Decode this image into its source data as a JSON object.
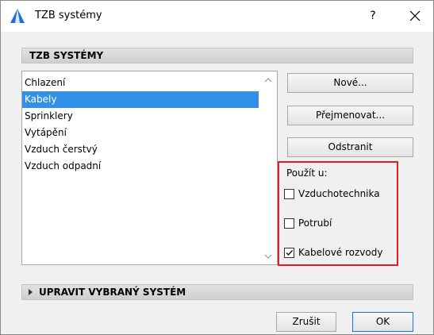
{
  "window": {
    "title": "TZB systémy",
    "help_label": "?",
    "accent_color": "#3390e8"
  },
  "systems_section": {
    "header": "TZB SYSTÉMY",
    "items": [
      {
        "label": "Chlazení",
        "selected": false
      },
      {
        "label": "Kabely",
        "selected": true
      },
      {
        "label": "Sprinklery",
        "selected": false
      },
      {
        "label": "Vytápění",
        "selected": false
      },
      {
        "label": "Vzduch čerstvý",
        "selected": false
      },
      {
        "label": "Vzduch odpadní",
        "selected": false
      }
    ]
  },
  "actions": {
    "new_label": "Nové...",
    "rename_label": "Přejmenovat...",
    "remove_label": "Odstranit"
  },
  "usage": {
    "label": "Použít u:",
    "options": [
      {
        "label": "Vzduchotechnika",
        "checked": false
      },
      {
        "label": "Potrubí",
        "checked": false
      },
      {
        "label": "Kabelové rozvody",
        "checked": true
      }
    ]
  },
  "edit_section": {
    "header": "UPRAVIT VYBRANÝ SYSTÉM"
  },
  "footer": {
    "cancel_label": "Zrušit",
    "ok_label": "OK"
  }
}
